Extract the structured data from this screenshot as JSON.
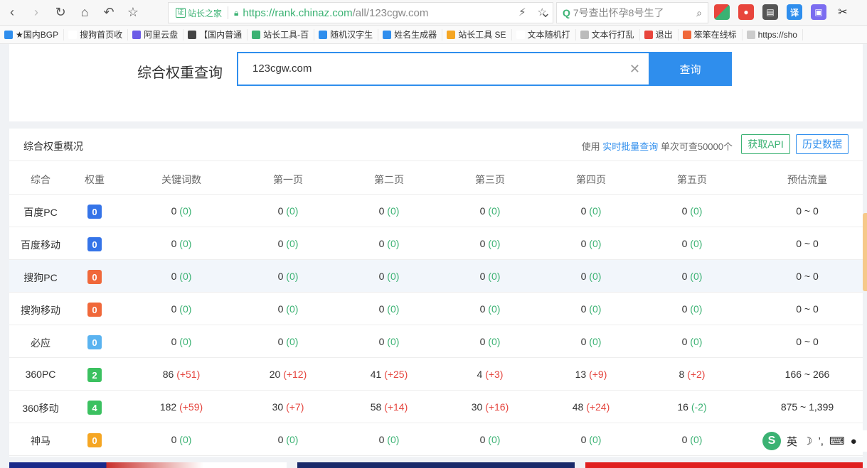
{
  "browser": {
    "site_badge": "站长之家",
    "url_host": "https://rank.chinaz.com",
    "url_path": "/all/123cgw.com",
    "search_text": "7号查出怀孕8号生了",
    "bookmarks": [
      "★国内BGP",
      "搜狗首页收",
      "阿里云盘",
      "【国内普通",
      "站长工具-百",
      "随机汉字生",
      "姓名生成器",
      "站长工具 SE",
      "文本随机打",
      "文本行打乱",
      "退出",
      "笨笨在线标",
      "https://sho"
    ],
    "ext_translate": "译"
  },
  "query": {
    "label": "综合权重查询",
    "value": "123cgw.com",
    "button": "查询"
  },
  "overview": {
    "title": "综合权重概况",
    "note_prefix": "使用 ",
    "note_link": "实时批量查询",
    "note_suffix": " 单次可查50000个",
    "api_button": "获取API",
    "history_button": "历史数据"
  },
  "table": {
    "headers": [
      "综合",
      "权重",
      "关键词数",
      "第一页",
      "第二页",
      "第三页",
      "第四页",
      "第五页",
      "预估流量"
    ],
    "rows": [
      {
        "name": "百度PC",
        "weight": "0",
        "color": "#3574e8",
        "cells": [
          [
            "0",
            "(0)",
            "g"
          ],
          [
            "0",
            "(0)",
            "g"
          ],
          [
            "0",
            "(0)",
            "g"
          ],
          [
            "0",
            "(0)",
            "g"
          ],
          [
            "0",
            "(0)",
            "g"
          ],
          [
            "0",
            "(0)",
            "g"
          ]
        ],
        "traffic": "0 ~ 0"
      },
      {
        "name": "百度移动",
        "weight": "0",
        "color": "#3574e8",
        "cells": [
          [
            "0",
            "(0)",
            "g"
          ],
          [
            "0",
            "(0)",
            "g"
          ],
          [
            "0",
            "(0)",
            "g"
          ],
          [
            "0",
            "(0)",
            "g"
          ],
          [
            "0",
            "(0)",
            "g"
          ],
          [
            "0",
            "(0)",
            "g"
          ]
        ],
        "traffic": "0 ~ 0"
      },
      {
        "name": "搜狗PC",
        "weight": "0",
        "color": "#f0683a",
        "cells": [
          [
            "0",
            "(0)",
            "g"
          ],
          [
            "0",
            "(0)",
            "g"
          ],
          [
            "0",
            "(0)",
            "g"
          ],
          [
            "0",
            "(0)",
            "g"
          ],
          [
            "0",
            "(0)",
            "g"
          ],
          [
            "0",
            "(0)",
            "g"
          ]
        ],
        "traffic": "0 ~ 0"
      },
      {
        "name": "搜狗移动",
        "weight": "0",
        "color": "#f0683a",
        "cells": [
          [
            "0",
            "(0)",
            "g"
          ],
          [
            "0",
            "(0)",
            "g"
          ],
          [
            "0",
            "(0)",
            "g"
          ],
          [
            "0",
            "(0)",
            "g"
          ],
          [
            "0",
            "(0)",
            "g"
          ],
          [
            "0",
            "(0)",
            "g"
          ]
        ],
        "traffic": "0 ~ 0"
      },
      {
        "name": "必应",
        "weight": "0",
        "color": "#5ab3f0",
        "cells": [
          [
            "0",
            "(0)",
            "g"
          ],
          [
            "0",
            "(0)",
            "g"
          ],
          [
            "0",
            "(0)",
            "g"
          ],
          [
            "0",
            "(0)",
            "g"
          ],
          [
            "0",
            "(0)",
            "g"
          ],
          [
            "0",
            "(0)",
            "g"
          ]
        ],
        "traffic": "0 ~ 0"
      },
      {
        "name": "360PC",
        "weight": "2",
        "color": "#3bc160",
        "cells": [
          [
            "86",
            "(+51)",
            "r"
          ],
          [
            "20",
            "(+12)",
            "r"
          ],
          [
            "41",
            "(+25)",
            "r"
          ],
          [
            "4",
            "(+3)",
            "r"
          ],
          [
            "13",
            "(+9)",
            "r"
          ],
          [
            "8",
            "(+2)",
            "r"
          ]
        ],
        "traffic": "166 ~ 266"
      },
      {
        "name": "360移动",
        "weight": "4",
        "color": "#3bc160",
        "cells": [
          [
            "182",
            "(+59)",
            "r"
          ],
          [
            "30",
            "(+7)",
            "r"
          ],
          [
            "58",
            "(+14)",
            "r"
          ],
          [
            "30",
            "(+16)",
            "r"
          ],
          [
            "48",
            "(+24)",
            "r"
          ],
          [
            "16",
            "(-2)",
            "g"
          ]
        ],
        "traffic": "875 ~ 1,399"
      },
      {
        "name": "神马",
        "weight": "0",
        "color": "#f5a623",
        "cells": [
          [
            "0",
            "(0)",
            "g"
          ],
          [
            "0",
            "(0)",
            "g"
          ],
          [
            "0",
            "(0)",
            "g"
          ],
          [
            "0",
            "(0)",
            "g"
          ],
          [
            "0",
            "(0)",
            "g"
          ],
          [
            "0",
            "(0)",
            "g"
          ]
        ],
        "traffic": ""
      }
    ]
  },
  "ime": {
    "lang": "英"
  }
}
